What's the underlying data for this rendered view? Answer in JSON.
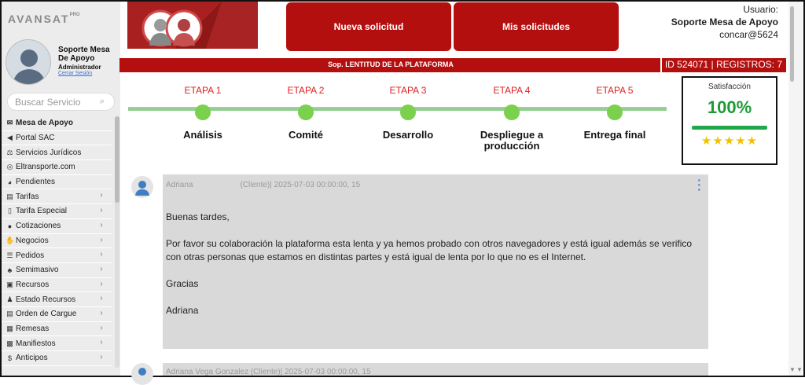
{
  "brand": {
    "logo": "AVANSAT",
    "mark": "PRO"
  },
  "user": {
    "name": "Soporte Mesa De Apoyo",
    "role": "Administrador",
    "logout": "Cerrar Sesión"
  },
  "search": {
    "placeholder": "Buscar Servicio"
  },
  "sidebar": {
    "items": [
      {
        "label": "Mesa de Apoyo",
        "icon": "chat-icon",
        "glyph": "✉",
        "chevron": false
      },
      {
        "label": "Portal SAC",
        "icon": "megaphone-icon",
        "glyph": "◀",
        "chevron": false
      },
      {
        "label": "Servicios Jurídicos",
        "icon": "scale-icon",
        "glyph": "⚖",
        "chevron": false
      },
      {
        "label": "Eltransporte.com",
        "icon": "globe-icon",
        "glyph": "◎",
        "chevron": false
      },
      {
        "label": "Pendientes",
        "icon": "pie-icon",
        "glyph": "◕",
        "chevron": false
      },
      {
        "label": "Tarifas",
        "icon": "calculator-icon",
        "glyph": "▤",
        "chevron": true
      },
      {
        "label": "Tarifa Especial",
        "icon": "bookmark-icon",
        "glyph": "▯",
        "chevron": true
      },
      {
        "label": "Cotizaciones",
        "icon": "comment-icon",
        "glyph": "●",
        "chevron": true
      },
      {
        "label": "Negocios",
        "icon": "handshake-icon",
        "glyph": "✋",
        "chevron": true
      },
      {
        "label": "Pedidos",
        "icon": "list-icon",
        "glyph": "☰",
        "chevron": true
      },
      {
        "label": "Semimasivo",
        "icon": "shapes-icon",
        "glyph": "♣",
        "chevron": true
      },
      {
        "label": "Recursos",
        "icon": "id-card-icon",
        "glyph": "▣",
        "chevron": true
      },
      {
        "label": "Estado Recursos",
        "icon": "users-icon",
        "glyph": "♟",
        "chevron": true
      },
      {
        "label": "Orden de Cargue",
        "icon": "file-icon",
        "glyph": "▤",
        "chevron": true
      },
      {
        "label": "Remesas",
        "icon": "receipt-icon",
        "glyph": "▦",
        "chevron": true
      },
      {
        "label": "Manifiestos",
        "icon": "address-card-icon",
        "glyph": "▩",
        "chevron": true
      },
      {
        "label": "Anticipos",
        "icon": "dollar-icon",
        "glyph": "$",
        "chevron": true
      }
    ]
  },
  "header": {
    "new_request": "Nueva solicitud",
    "my_requests": "Mis solicitudes",
    "user_label": "Usuario:",
    "user_name": "Soporte Mesa de Apoyo",
    "user_code": "concar@5624"
  },
  "ticket": {
    "title": "Sop. LENTITUD DE LA PLATAFORMA",
    "id_info": "ID 524071 | REGISTROS: 7"
  },
  "stages": [
    {
      "step": "ETAPA 1",
      "name": "Análisis"
    },
    {
      "step": "ETAPA 2",
      "name": "Comité"
    },
    {
      "step": "ETAPA 3",
      "name": "Desarrollo"
    },
    {
      "step": "ETAPA 4",
      "name": "Despliegue a producción"
    },
    {
      "step": "ETAPA 5",
      "name": "Entrega final"
    }
  ],
  "satisfaction": {
    "label": "Satisfacción",
    "value": "100%",
    "stars": "★★★★★",
    "rating": 5
  },
  "comments": [
    {
      "author": "Adriana",
      "meta": "(Cliente)| 2025-07-03 00:00:00, 15",
      "greeting": "Buenas tardes,",
      "body": "Por favor su colaboración la plataforma esta lenta y ya hemos probado con otros navegadores y está igual además se verifico con otras personas que estamos en distintas partes y está igual de lenta por lo que no es el Internet.",
      "thanks": "Gracias",
      "signature": "Adriana"
    },
    {
      "meta": "Adriana Vega Gonzalez (Cliente)| 2025-07-03 00:00:00, 15"
    }
  ],
  "colors": {
    "accent": "#b30f0f",
    "success": "#1f9a35",
    "stage_dot": "#7bd04e",
    "stage_label": "#e02020",
    "star": "#f2c200"
  }
}
